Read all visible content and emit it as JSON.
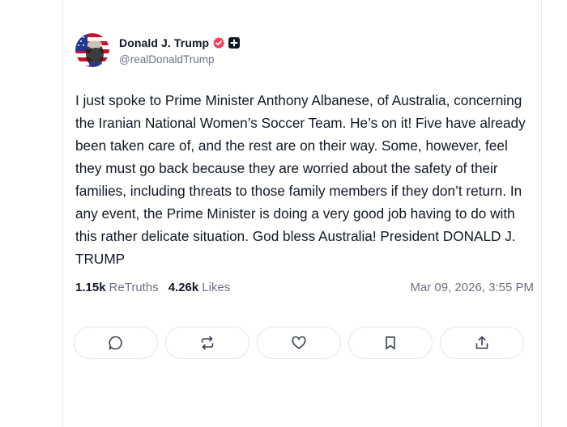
{
  "author": {
    "name": "Donald J. Trump",
    "handle": "@realDonaldTrump",
    "verified_color": "#f43f5e"
  },
  "post": {
    "text": "I just spoke to Prime Minister Anthony Albanese, of Australia, concerning the Iranian National Women’s Soccer Team. He’s on it! Five have already been taken care of, and the rest are on their way. Some, however, feel they must go back because they are worried about the safety of their families, including threats to those family members if they don’t return. In any event, the Prime Minister is doing a very good job having to do with this rather delicate situation. God bless Australia! President DONALD J. TRUMP"
  },
  "stats": {
    "retruths_count": "1.15k",
    "retruths_label": "ReTruths",
    "likes_count": "4.26k",
    "likes_label": "Likes",
    "timestamp": "Mar 09, 2026, 3:55 PM"
  },
  "actions": [
    {
      "name": "reply",
      "icon": "comment-icon"
    },
    {
      "name": "retruth",
      "icon": "repost-icon"
    },
    {
      "name": "like",
      "icon": "heart-icon"
    },
    {
      "name": "bookmark",
      "icon": "bookmark-icon"
    },
    {
      "name": "share",
      "icon": "share-icon"
    }
  ],
  "colors": {
    "text": "#111827",
    "muted": "#6b7280",
    "border": "#e5e7eb"
  }
}
